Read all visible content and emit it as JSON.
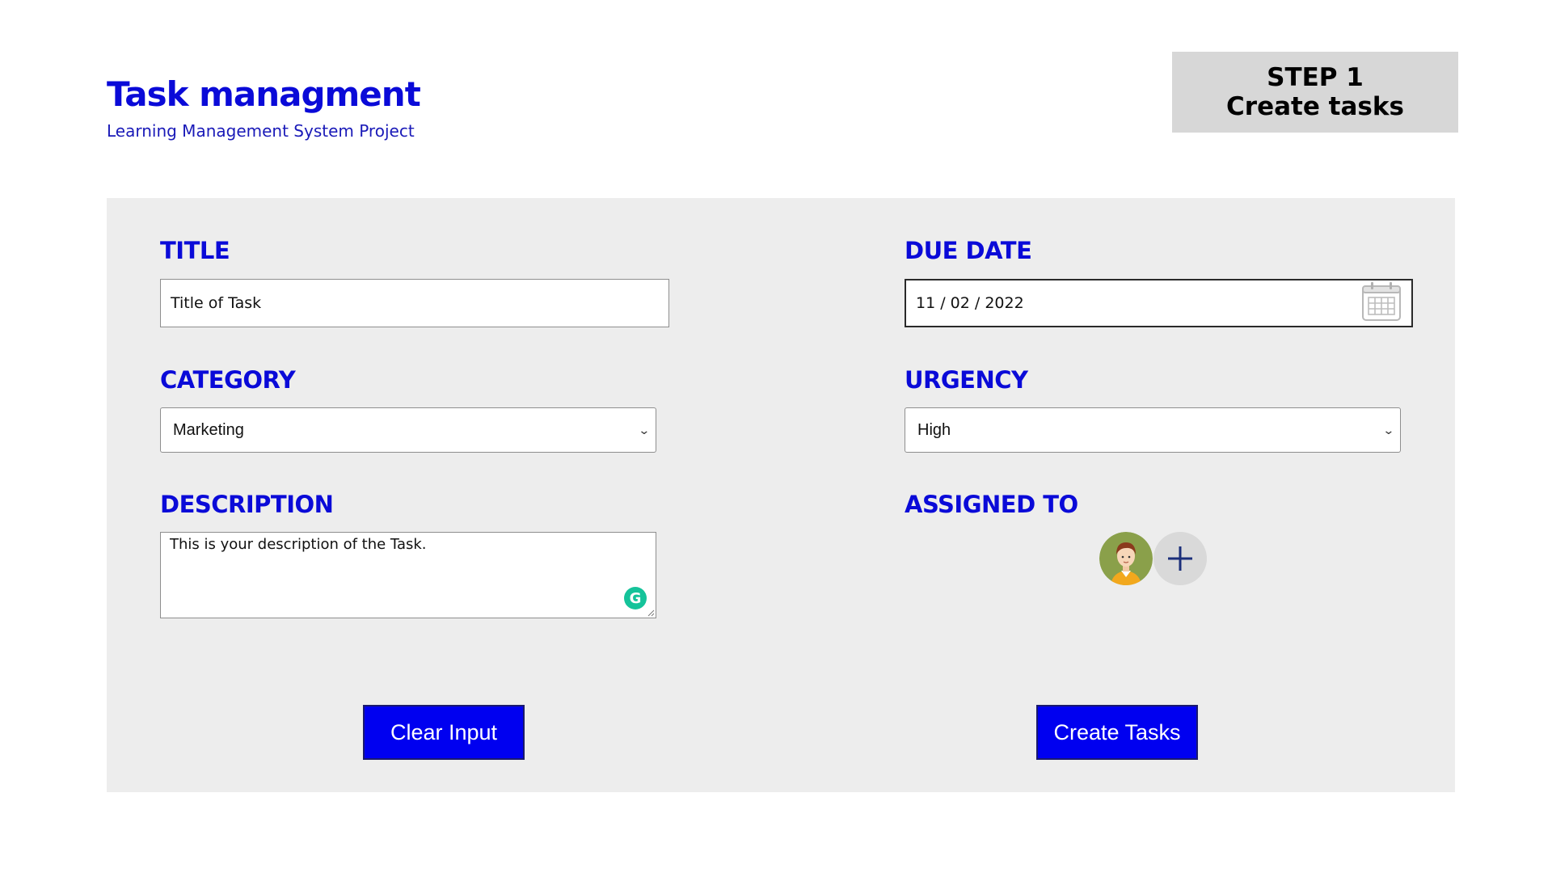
{
  "header": {
    "title": "Task managment",
    "subtitle": "Learning Management System Project",
    "step": {
      "line1": "STEP 1",
      "line2": "Create tasks"
    }
  },
  "form": {
    "title": {
      "label": "TITLE",
      "value": "Title of Task"
    },
    "due_date": {
      "label": "DUE DATE",
      "value": "11 / 02 / 2022",
      "icon": "calendar-icon"
    },
    "category": {
      "label": "CATEGORY",
      "selected": "Marketing"
    },
    "urgency": {
      "label": "URGENCY",
      "selected": "High"
    },
    "description": {
      "label": "DESCRIPTION",
      "value": "This is your description of the Task.",
      "extension_icon": "grammarly-icon"
    },
    "assigned_to": {
      "label": "ASSIGNED TO",
      "avatar_icon": "user-avatar-icon",
      "add_icon": "plus-icon"
    }
  },
  "actions": {
    "clear_label": "Clear Input",
    "create_label": "Create Tasks"
  },
  "colors": {
    "accent": "#0a0ad8",
    "button_bg": "#0000f0",
    "panel_bg": "#ededed",
    "step_bg": "#d7d7d7",
    "grammarly": "#15c39a"
  }
}
